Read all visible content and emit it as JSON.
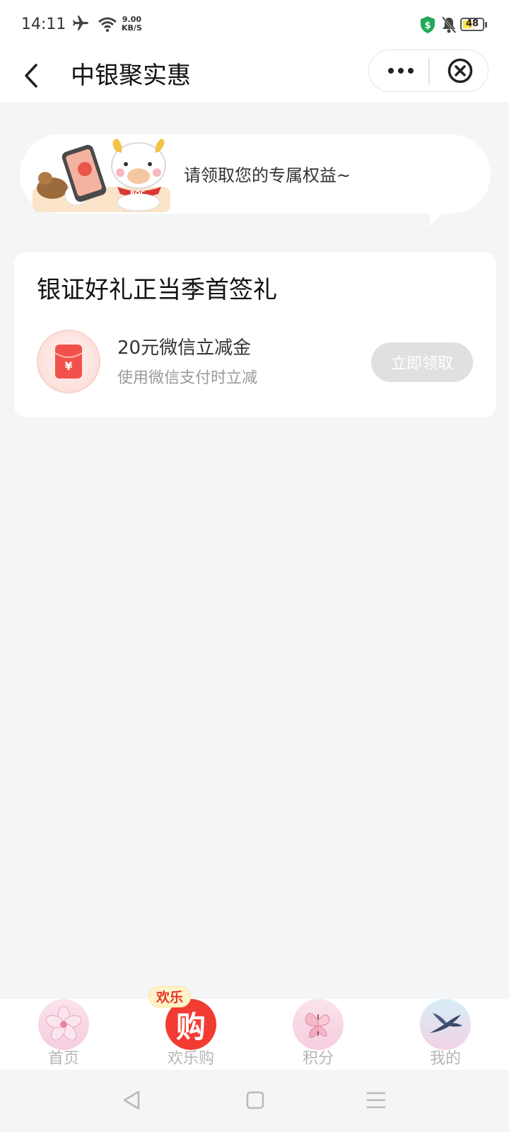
{
  "status_bar": {
    "time": "14:11",
    "net_speed_value": "9.00",
    "net_speed_unit": "KB/S",
    "battery": "48",
    "icons": [
      "airplane-icon",
      "wifi-icon",
      "shield-icon",
      "bell-muted-icon",
      "battery-icon"
    ]
  },
  "nav": {
    "title": "中银聚实惠",
    "back_icon": "chevron-left-icon",
    "more_icon": "more-dots-icon",
    "close_icon": "close-circle-icon"
  },
  "banner": {
    "text": "请领取您的专属权益~",
    "mascot_text": "BOC"
  },
  "card": {
    "title": "银证好礼正当季首签礼",
    "coupon": {
      "icon_symbol": "¥",
      "name": "20元微信立减金",
      "description": "使用微信支付时立减",
      "button_label": "立即领取"
    }
  },
  "tab_bar": {
    "items": [
      {
        "label": "首页",
        "icon": "sakura-icon"
      },
      {
        "label": "欢乐购",
        "icon": "shop-gou-icon",
        "badge": "欢乐",
        "icon_char": "购"
      },
      {
        "label": "积分",
        "icon": "butterfly-icon"
      },
      {
        "label": "我的",
        "icon": "swallow-icon"
      }
    ]
  },
  "colors": {
    "accent_red": "#f23c33",
    "disabled_button": "#e0e0e0",
    "page_bg": "#f4f5f7",
    "tab_label": "#b5b5b5"
  }
}
